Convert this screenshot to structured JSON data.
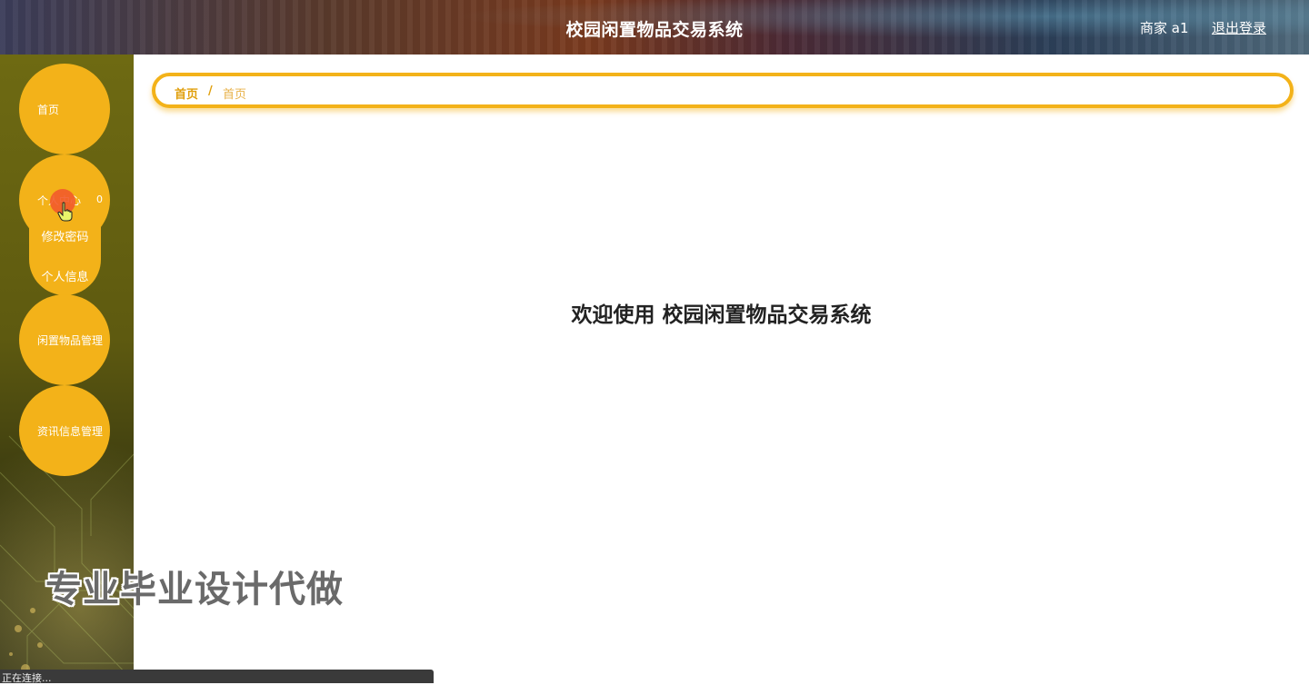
{
  "header": {
    "title": "校园闲置物品交易系统",
    "user_label": "商家 a1",
    "logout_label": "退出登录"
  },
  "sidebar": {
    "items": [
      {
        "label": "首页"
      },
      {
        "label": "个人中心"
      },
      {
        "label": "闲置物品管理"
      },
      {
        "label": "资讯信息管理"
      }
    ],
    "submenu": [
      {
        "label": "修改密码"
      },
      {
        "label": "个人信息"
      }
    ],
    "expand_arrow": "0"
  },
  "breadcrumb": {
    "home": "首页",
    "separator": "/",
    "current": "首页"
  },
  "main": {
    "welcome": "欢迎使用 校园闲置物品交易系统"
  },
  "watermark": "专业毕业设计代做",
  "status": {
    "text": "正在连接..."
  },
  "colors": {
    "accent": "#f3b219",
    "breadcrumb_text": "#e09f0c",
    "sidebar_bg": "#6e6a12"
  }
}
